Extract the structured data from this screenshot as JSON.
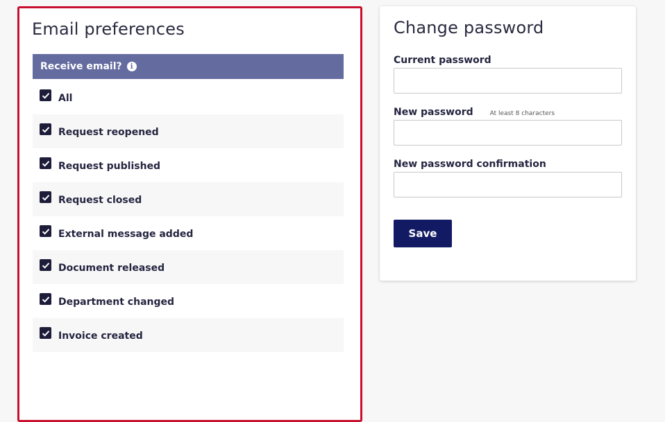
{
  "email_preferences": {
    "title": "Email preferences",
    "header_label": "Receive email?",
    "info_icon": "i",
    "items": [
      {
        "label": "All",
        "checked": true
      },
      {
        "label": "Request reopened",
        "checked": true
      },
      {
        "label": "Request published",
        "checked": true
      },
      {
        "label": "Request closed",
        "checked": true
      },
      {
        "label": "External message added",
        "checked": true
      },
      {
        "label": "Document released",
        "checked": true
      },
      {
        "label": "Department changed",
        "checked": true
      },
      {
        "label": "Invoice created",
        "checked": true
      }
    ]
  },
  "change_password": {
    "title": "Change password",
    "current_label": "Current password",
    "current_value": "",
    "new_label": "New password",
    "new_hint": "At least 8 characters",
    "new_value": "",
    "confirm_label": "New password confirmation",
    "confirm_value": "",
    "save_label": "Save"
  },
  "colors": {
    "highlight_border": "#c8102e",
    "header_bg": "#646b9f",
    "button_bg": "#121a63",
    "checkbox": "#1d1d3a"
  }
}
